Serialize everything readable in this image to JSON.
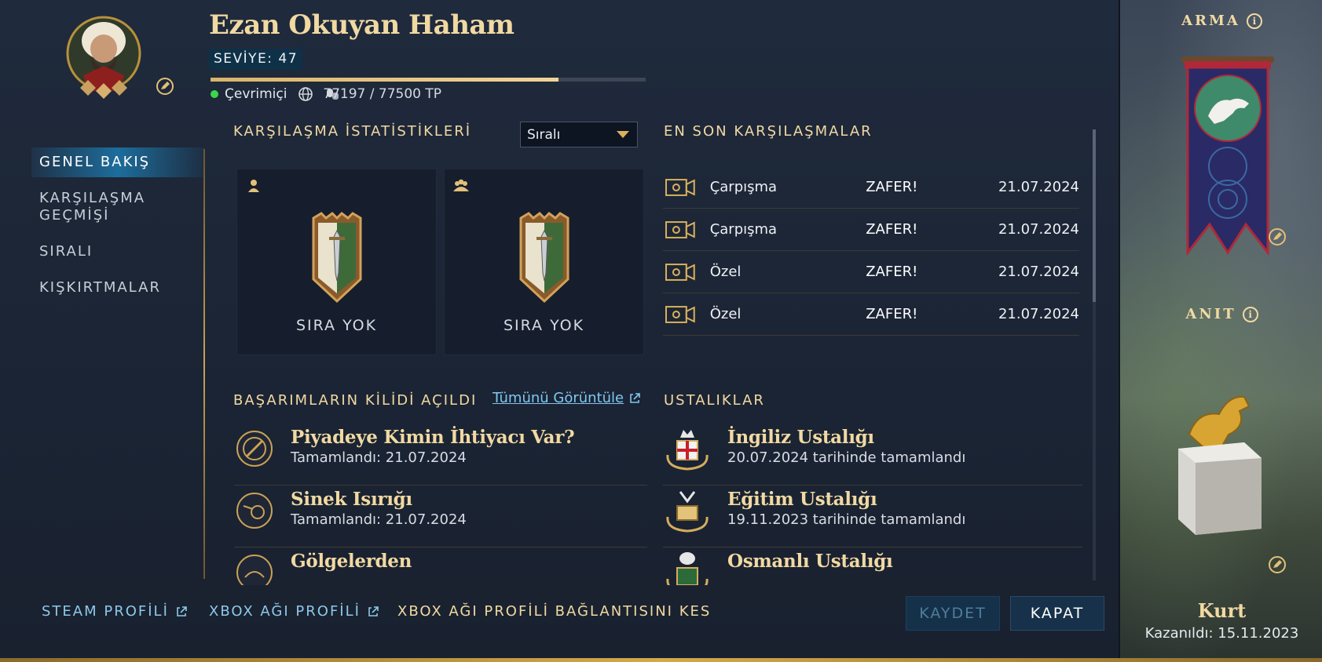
{
  "profile": {
    "name": "Ezan Okuyan Haham",
    "level_label": "SEVİYE: 47",
    "xp_text": "77197 / 77500 TP",
    "xp_progress": 0.8,
    "status": "Çevrimiçi",
    "status_color": "#3cd64a"
  },
  "nav": {
    "items": [
      {
        "label": "GENEL BAKIŞ",
        "active": true
      },
      {
        "label": "KARŞILAŞMA GEÇMİŞİ",
        "active": false
      },
      {
        "label": "SIRALI",
        "active": false
      },
      {
        "label": "KIŞKIRTMALAR",
        "active": false
      }
    ]
  },
  "stats": {
    "title": "KARŞILAŞMA İSTATİSTİKLERİ",
    "dropdown_value": "Sıralı",
    "cards": [
      {
        "mode_icon": "solo-player-icon",
        "rank": "SIRA YOK"
      },
      {
        "mode_icon": "team-players-icon",
        "rank": "SIRA YOK"
      }
    ]
  },
  "recent": {
    "title": "EN SON KARŞILAŞMALAR",
    "matches": [
      {
        "type": "Çarpışma",
        "result": "ZAFER!",
        "date": "21.07.2024"
      },
      {
        "type": "Çarpışma",
        "result": "ZAFER!",
        "date": "21.07.2024"
      },
      {
        "type": "Özel",
        "result": "ZAFER!",
        "date": "21.07.2024"
      },
      {
        "type": "Özel",
        "result": "ZAFER!",
        "date": "21.07.2024"
      }
    ]
  },
  "achievements": {
    "title": "BAŞARIMLARIN KİLİDİ AÇILDI",
    "view_all": "Tümünü Görüntüle",
    "items": [
      {
        "title": "Piyadeye Kimin İhtiyacı Var?",
        "subtitle": "Tamamlandı: 21.07.2024"
      },
      {
        "title": "Sinek Isırığı",
        "subtitle": "Tamamlandı: 21.07.2024"
      },
      {
        "title": "Gölgelerden",
        "subtitle": ""
      }
    ]
  },
  "masteries": {
    "title": "USTALIKLAR",
    "items": [
      {
        "title": "İngiliz Ustalığı",
        "subtitle": "20.07.2024 tarihinde tamamlandı"
      },
      {
        "title": "Eğitim Ustalığı",
        "subtitle": "19.11.2023 tarihinde tamamlandı"
      },
      {
        "title": "Osmanlı Ustalığı",
        "subtitle": ""
      }
    ]
  },
  "footer": {
    "steam": "STEAM PROFİLİ",
    "xbox": "XBOX AĞI PROFİLİ",
    "unlink": "XBOX AĞI PROFİLİ BAĞLANTISINI KES",
    "save": "KAYDET",
    "close": "KAPAT"
  },
  "side": {
    "arms_title": "ARMA",
    "monument_title": "ANIT",
    "monument_name": "Kurt",
    "monument_earned": "Kazanıldı: 15.11.2023"
  }
}
